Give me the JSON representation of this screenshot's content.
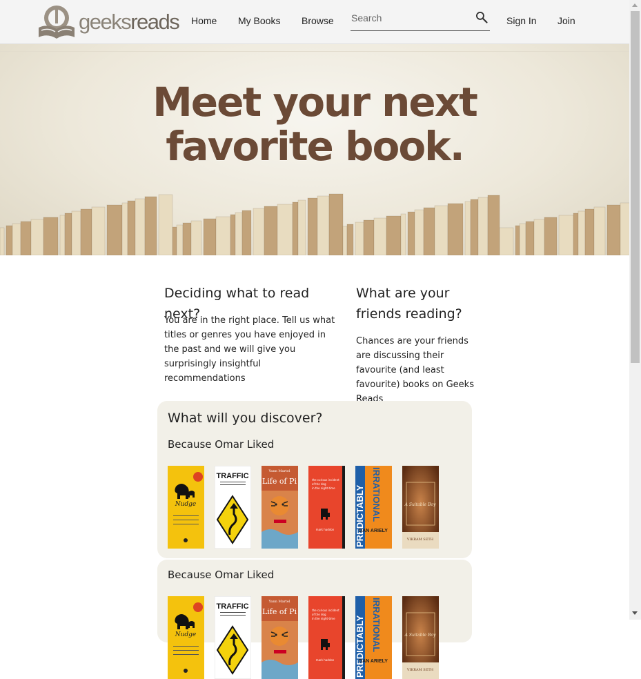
{
  "header": {
    "logo_a": "geeks",
    "logo_b": "reads",
    "nav": [
      {
        "label": "Home"
      },
      {
        "label": "My Books"
      },
      {
        "label": "Browse"
      }
    ],
    "search_placeholder": "Search",
    "sign_in": "Sign In",
    "join": "Join"
  },
  "hero": {
    "title_line1": "Meet your next",
    "title_line2": "favorite book."
  },
  "info": {
    "left_heading": "Deciding what to read next?",
    "left_text": "You are in the right place. Tell us what titles or genres you have enjoyed in the past and we will give you surprisingly insightful recommendations",
    "right_heading": "What are your friends reading?",
    "right_text": "Chances are your friends are discussing their favourite (and least favourite) books on Geeks Reads"
  },
  "discover": {
    "title": "What will you discover?",
    "groups": [
      {
        "label": "Because Omar Liked"
      },
      {
        "label": "Because Omar Liked"
      }
    ],
    "books": [
      {
        "icon": "nudge-cover",
        "cover_text": "Nudge",
        "color": "#f4c20d"
      },
      {
        "icon": "traffic-cover",
        "cover_text": "TRAFFIC",
        "color": "#ffffff"
      },
      {
        "icon": "life-of-pi-cover",
        "cover_text": "Life of Pi",
        "color": "#d9834a"
      },
      {
        "icon": "curious-incident-cover",
        "cover_text": "the curious incident of the dog in the night-time",
        "color": "#e8452c"
      },
      {
        "icon": "predictably-irrational-cover",
        "cover_text": "PREDICTABLY IRRATIONAL",
        "color": "#f08a1c"
      },
      {
        "icon": "suitable-boy-cover",
        "cover_text": "A Suitable Boy",
        "color": "#9a5a2a"
      }
    ]
  },
  "colors": {
    "hero_title": "#6b4a36",
    "panel_bg": "#f2f0e8",
    "topbar_bg": "#f4f4f4"
  }
}
